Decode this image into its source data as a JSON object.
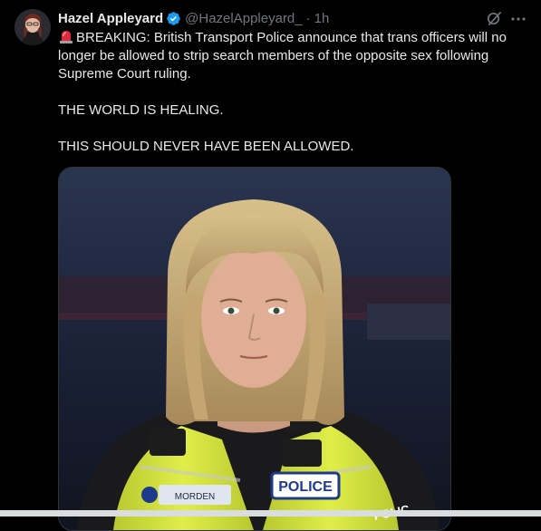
{
  "tweet": {
    "display_name": "Hazel Appleyard",
    "handle": "@HazelAppleyard_",
    "separator": "·",
    "time": "1h",
    "paragraphs": [
      "BREAKING: British Transport Police announce that trans officers will no longer be allowed to strip search members of the opposite sex following Supreme Court ruling.",
      "THE WORLD IS HEALING.",
      "THIS SHOULD NEVER HAVE BEEN ALLOWED."
    ],
    "media": {
      "badge_text": "POLICE",
      "name_badge_text": "MORDEN",
      "back_text": "POLIC"
    }
  },
  "icons": {
    "verified": "verified-badge-icon",
    "siren": "rotating-light-emoji-icon",
    "grok": "grok-icon",
    "more": "more-icon"
  },
  "colors": {
    "background": "#000000",
    "text": "#e7e9ea",
    "secondary_text": "#71767b",
    "verified_blue": "#1d9bf0",
    "hi_vis_yellow": "#d8e83a"
  }
}
